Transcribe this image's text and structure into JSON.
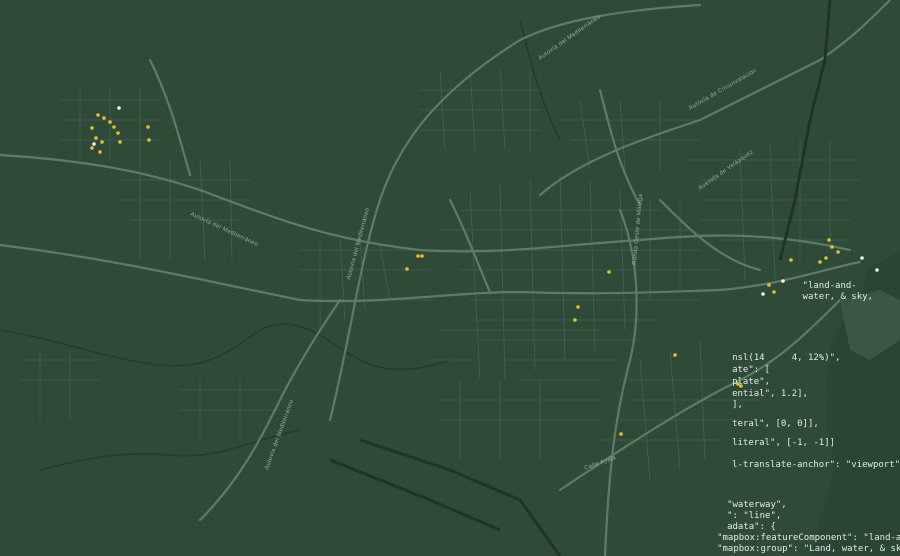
{
  "map": {
    "colors": {
      "background": "#2f4a38",
      "road_major": "#5b7d67",
      "road_minor": "#436250",
      "rail": "#203328",
      "water": "#233a2c",
      "point_yellow": "#e4c42c",
      "point_white": "#f2f2ea"
    },
    "road_labels": [
      {
        "text": "Autovía del Mediterráneo",
        "id": "label-a7-north"
      },
      {
        "text": "Autovía del Mediterráneo",
        "id": "label-a7-northeast"
      },
      {
        "text": "Autovía de Circunvalación",
        "id": "label-circunvalacion"
      },
      {
        "text": "Autovía del Mediterráneo",
        "id": "label-a7-west"
      },
      {
        "text": "Autovía del Mediterráneo",
        "id": "label-a7-south"
      },
      {
        "text": "Ronda Oeste de Málaga",
        "id": "label-ronda-oeste"
      },
      {
        "text": "Avenida de Velázquez",
        "id": "label-velazquez"
      },
      {
        "text": "Calle Ayala",
        "id": "label-ayala"
      }
    ]
  },
  "code_overlay": {
    "lines": [
      "                  \"land-and-",
      "                  water, & sky,",
      "     nsl(14     4, 12%)\",",
      "     ate\": [",
      "     plate\",",
      "     ential\", 1.2],",
      "     ],",
      "     teral\", [0, 0]],",
      "     literal\", [-1, -1]]",
      "     l-translate-anchor\": \"viewport\"",
      "     \"waterway\",",
      "     \": \"line\",",
      "     adata\": {",
      "     \"mapbox:featureComponent\": \"land-and-",
      "     \"mapbox:group\": \"Land, water, & sky,"
    ]
  }
}
